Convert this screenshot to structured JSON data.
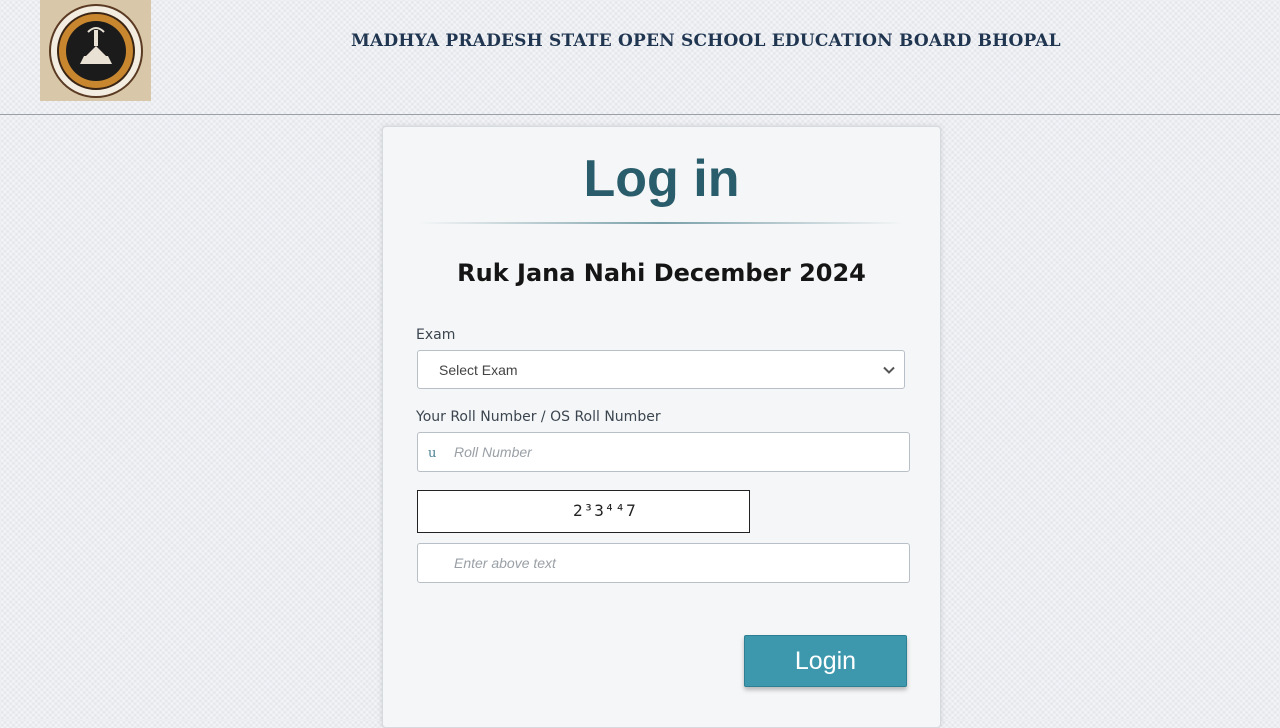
{
  "header": {
    "title": "MADHYA PRADESH STATE OPEN SCHOOL EDUCATION BOARD BHOPAL",
    "logo_icon": "board-seal-icon"
  },
  "login_card": {
    "title": "Log in",
    "exam_heading": "Ruk Jana Nahi December 2024",
    "exam_field": {
      "label": "Exam",
      "selected_value": "Select Exam"
    },
    "roll_field": {
      "label": "Your Roll Number / OS Roll Number",
      "icon": "u",
      "placeholder": "Roll Number",
      "value": ""
    },
    "captcha": {
      "text": "2³3⁴⁴7"
    },
    "captcha_field": {
      "placeholder": "Enter above text",
      "value": ""
    },
    "login_button": "Login"
  },
  "colors": {
    "title": "#2a5d6b",
    "button": "#3e98ad",
    "header_text": "#1f3550"
  }
}
